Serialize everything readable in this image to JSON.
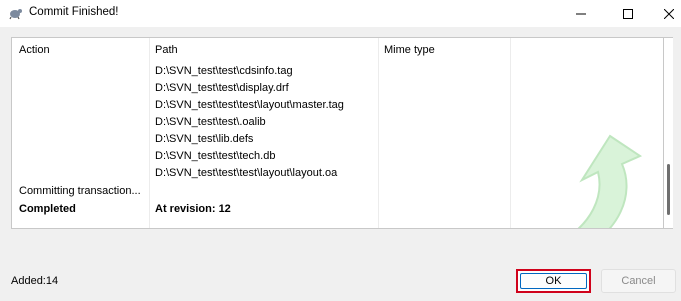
{
  "window": {
    "title": "Commit Finished!",
    "icon": "tortoise-svn-icon",
    "controls": [
      "minimize",
      "maximize",
      "close"
    ]
  },
  "list": {
    "headers": {
      "action": "Action",
      "path": "Path",
      "mime": "Mime type"
    },
    "rows": [
      {
        "action": "",
        "path": "D:\\SVN_test\\test\\cdsinfo.tag"
      },
      {
        "action": "",
        "path": "D:\\SVN_test\\test\\display.drf"
      },
      {
        "action": "",
        "path": "D:\\SVN_test\\test\\test\\layout\\master.tag"
      },
      {
        "action": "",
        "path": "D:\\SVN_test\\test\\.oalib"
      },
      {
        "action": "",
        "path": "D:\\SVN_test\\lib.defs"
      },
      {
        "action": "",
        "path": "D:\\SVN_test\\test\\tech.db"
      },
      {
        "action": "",
        "path": "D:\\SVN_test\\test\\test\\layout\\layout.oa"
      },
      {
        "action": "Committing transaction...",
        "path": ""
      },
      {
        "action": "Completed",
        "path": "At revision: 12"
      }
    ]
  },
  "status": {
    "added": "Added:14"
  },
  "buttons": {
    "ok": "OK",
    "cancel": "Cancel"
  },
  "colors": {
    "highlight": "#d0021b",
    "focus": "#0067c0",
    "watermark": "#c8ecc8"
  }
}
